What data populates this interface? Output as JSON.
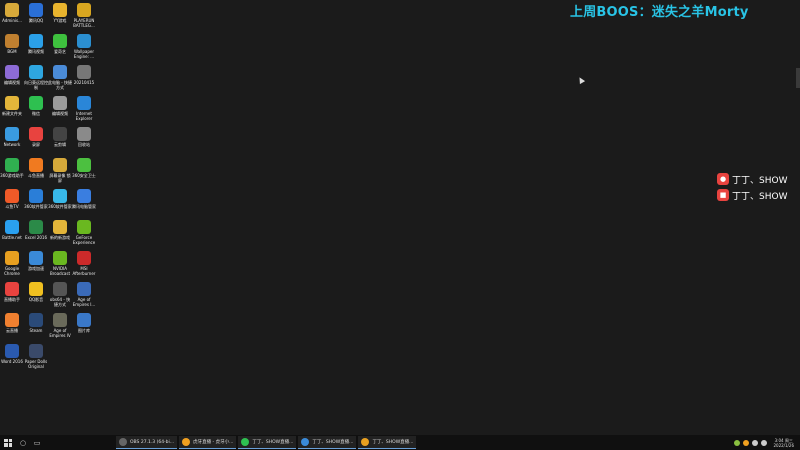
{
  "overlay": {
    "title": "上周BOOS：迷失之羊Morty"
  },
  "badges": [
    {
      "text": "丁丁、SHOW"
    },
    {
      "text": "丁丁、SHOW"
    }
  ],
  "desktop_icons": [
    {
      "label": "Adminis...",
      "color": "#d7a93a"
    },
    {
      "label": "腾讯QQ",
      "color": "#2a6fd6"
    },
    {
      "label": "YY游戏",
      "color": "#e9b42e"
    },
    {
      "label": "PLAYERUN BATTLEG...",
      "color": "#d8a620"
    },
    {
      "label": "BGM",
      "color": "#c08030"
    },
    {
      "label": "腾讯视频",
      "color": "#2ba0e8"
    },
    {
      "label": "爱奇艺",
      "color": "#3ec13e"
    },
    {
      "label": "Wallpaper Engine: ...",
      "color": "#2b8fd0"
    },
    {
      "label": "编辑视频",
      "color": "#8d6bd6"
    },
    {
      "label": "向日葵远程控制",
      "color": "#2ea6e0"
    },
    {
      "label": "此电脑 - 快捷方式",
      "color": "#4a8bd8"
    },
    {
      "label": "20210415",
      "color": "#777777"
    },
    {
      "label": "新建文件夹",
      "color": "#e3b53a"
    },
    {
      "label": "微信",
      "color": "#2ec050"
    },
    {
      "label": "编辑视频",
      "color": "#9a9a9a"
    },
    {
      "label": "Internet Explorer",
      "color": "#2a86d8"
    },
    {
      "label": "Network",
      "color": "#3a9be0"
    },
    {
      "label": "录屏",
      "color": "#e8433f"
    },
    {
      "label": "云剪辑",
      "color": "#444444"
    },
    {
      "label": "回收站",
      "color": "#8a8a8a"
    },
    {
      "label": "360游戏助手",
      "color": "#30b050"
    },
    {
      "label": "斗鱼直播",
      "color": "#f07a20"
    },
    {
      "label": "屏幕录像 锁屏",
      "color": "#d6a93a"
    },
    {
      "label": "360安全卫士",
      "color": "#4cc040"
    },
    {
      "label": "斗鱼TV",
      "color": "#f05a28"
    },
    {
      "label": "360软件管家",
      "color": "#2a7ed8"
    },
    {
      "label": "360软件管家",
      "color": "#38b8e8"
    },
    {
      "label": "腾讯电脑管家",
      "color": "#3a7ee0"
    },
    {
      "label": "Battle.net",
      "color": "#2aa0f0"
    },
    {
      "label": "Excel 2016",
      "color": "#2b8a48"
    },
    {
      "label": "新的新游戏",
      "color": "#e3b53a"
    },
    {
      "label": "GeForce Experience",
      "color": "#6ab820"
    },
    {
      "label": "Google Chrome",
      "color": "#e8a020"
    },
    {
      "label": "游戏加速",
      "color": "#3a8ad8"
    },
    {
      "label": "NVIDIA Broadcast",
      "color": "#6ab820"
    },
    {
      "label": "MSI Afterburner",
      "color": "#cc2a2a"
    },
    {
      "label": "直播助手",
      "color": "#e8433f"
    },
    {
      "label": "QQ影音",
      "color": "#f0c020"
    },
    {
      "label": "obs64 - 快捷方式",
      "color": "#555555"
    },
    {
      "label": "Age of Empires I...",
      "color": "#3a6ab8"
    },
    {
      "label": "云直播",
      "color": "#f08030"
    },
    {
      "label": "Steam",
      "color": "#2a4a78"
    },
    {
      "label": "Age of Empires IV",
      "color": "#6a6a5a"
    },
    {
      "label": "图片库",
      "color": "#3a78c8"
    },
    {
      "label": "Word 2016",
      "color": "#2a5ab0"
    },
    {
      "label": "Paper Dolls Original",
      "color": "#3a4a6a"
    }
  ],
  "taskbar": {
    "tasks": [
      {
        "label": "OBS 27.1.3 (64-bi...",
        "color": "#666666"
      },
      {
        "label": "虎牙直播 - 虎牙小...",
        "color": "#f0a020"
      },
      {
        "label": "丁丁、SHOW直播...",
        "color": "#2ec050"
      },
      {
        "label": "丁丁、SHOW直播...",
        "color": "#3a8ad8"
      },
      {
        "label": "丁丁、SHOW直播...",
        "color": "#e8a020"
      }
    ],
    "clock_time": "3:04 周三",
    "clock_date": "2022/1/26"
  }
}
